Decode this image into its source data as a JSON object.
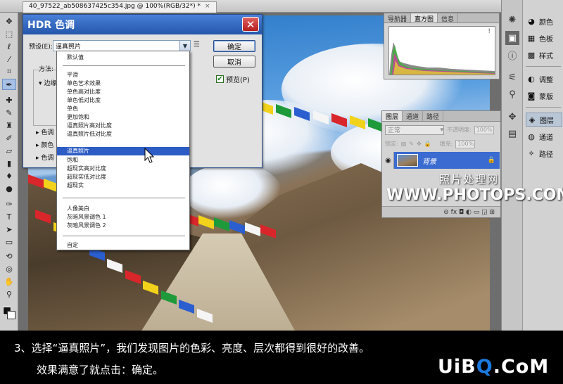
{
  "document": {
    "tab_title": "40_97522_ab508637425c354.jpg @ 100%(RGB/32*) *",
    "tab_close": "×"
  },
  "colors": {
    "dialog_title_bar": "#2456ab",
    "highlight": "#2c5cc4",
    "close_button": "#c83232",
    "layer_selected": "#3a6bd0",
    "logo_accent": "#1a7ae0"
  },
  "toolbar": {
    "tools": [
      "move-icon",
      "marquee-icon",
      "lasso-icon",
      "quick-select-icon",
      "crop-icon",
      "eyedropper-icon",
      "healing-icon",
      "brush-icon",
      "stamp-icon",
      "history-brush-icon",
      "eraser-icon",
      "gradient-icon",
      "blur-icon",
      "dodge-icon",
      "pen-icon",
      "type-icon",
      "path-select-icon",
      "shape-icon",
      "3d-rotate-icon",
      "3d-orbit-icon",
      "hand-icon",
      "zoom-icon"
    ]
  },
  "dock": {
    "icons": [
      "color-wheel-icon",
      "swatches-icon",
      "styles-icon",
      "adjustments-icon",
      "masks-icon",
      "layers-icon",
      "channels-icon",
      "paths-icon"
    ],
    "labels": {
      "color": "颜色",
      "swatches": "色板",
      "styles": "样式",
      "adjustments": "调整",
      "masks": "蒙版",
      "layers": "图层",
      "channels": "通道",
      "paths": "路径"
    }
  },
  "histogram_panel": {
    "tabs": [
      "导航器",
      "直方图",
      "信息"
    ],
    "active_tab": "直方图",
    "warning": "!"
  },
  "layers_panel": {
    "tabs": [
      "图层",
      "通道",
      "路径"
    ],
    "blend_mode": "正常",
    "opacity_label": "不透明度:",
    "opacity_value": "100%",
    "lock_label": "锁定:",
    "fill_label": "填充:",
    "fill_value": "100%",
    "layer_name": "背景",
    "footer_icons": "⊖ fx ◘ ◐ ▭ ◲ ⊞"
  },
  "watermark": {
    "cn": "照片处理网",
    "en": "WWW.PHOTOPS.COM"
  },
  "hdr_dialog": {
    "title": "HDR 色调",
    "close": "✕",
    "preset_label": "预设(E):",
    "preset_value": "逼真照片",
    "ok": "确定",
    "cancel": "取消",
    "preview_label": "预览(P)",
    "method_label": "方法:",
    "edge_label": "边缘",
    "collapsed_rows": [
      "色调",
      "颜色",
      "色调"
    ]
  },
  "preset_menu": {
    "items": [
      "默认值",
      "平滑",
      "单色艺术效果",
      "单色高对比度",
      "单色低对比度",
      "单色",
      "更加饱和",
      "逼真照片高对比度",
      "逼真照片低对比度",
      "逼真照片",
      "饱和",
      "超现实高对比度",
      "超现实低对比度",
      "超现实",
      "人像美白",
      "灰暗风景调色 1",
      "灰暗风景调色 2",
      "自定"
    ],
    "selected": "逼真照片"
  },
  "caption": {
    "line1": "3、选择“逼真照片”，我们发现图片的色彩、亮度、层次都得到很好的改善。",
    "line2": "效果满意了就点击：确定。",
    "logo_pre": "UiB",
    "logo_q": "Q",
    "logo_post": ".CoM"
  }
}
